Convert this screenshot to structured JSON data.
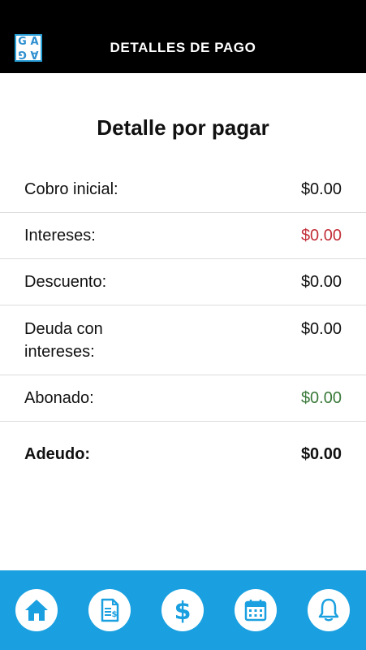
{
  "header": {
    "logo_letters": [
      "G",
      "A",
      "G",
      "A"
    ],
    "title": "DETALLES DE PAGO"
  },
  "main": {
    "title": "Detalle por pagar",
    "rows": [
      {
        "label": "Cobro inicial:",
        "value": "$0.00"
      },
      {
        "label": "Intereses:",
        "value": "$0.00"
      },
      {
        "label": "Descuento:",
        "value": "$0.00"
      },
      {
        "label": "Deuda con intereses:",
        "value": "$0.00"
      },
      {
        "label": "Abonado:",
        "value": "$0.00"
      }
    ],
    "total": {
      "label": "Adeudo:",
      "value": "$0.00"
    }
  },
  "colors": {
    "header_bg": "#000000",
    "tabbar_bg": "#1aa0e0",
    "icon_blue": "#1aa0e0",
    "interest_red": "#c3303a",
    "paid_green": "#3a7a3a"
  },
  "tabbar": {
    "icons": [
      "home-icon",
      "invoice-icon",
      "dollar-icon",
      "calendar-icon",
      "bell-icon"
    ]
  }
}
